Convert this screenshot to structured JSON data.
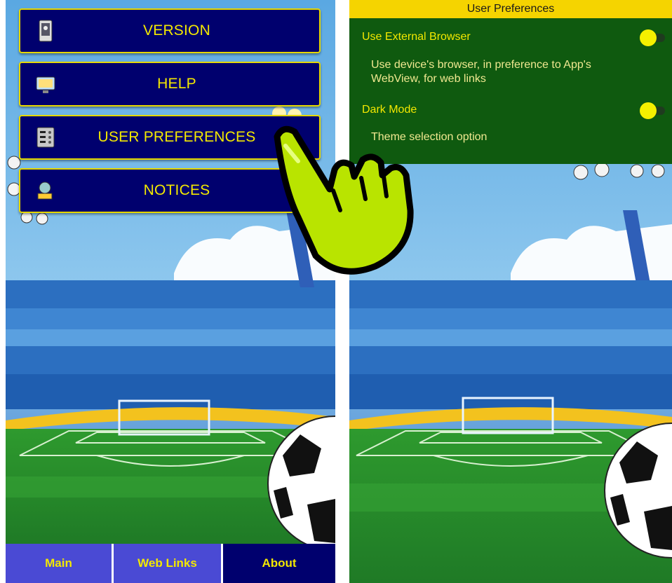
{
  "left": {
    "menu": [
      {
        "label": "VERSION",
        "icon": "phone-icon"
      },
      {
        "label": "HELP",
        "icon": "monitor-icon"
      },
      {
        "label": "USER PREFERENCES",
        "icon": "preferences-icon"
      },
      {
        "label": "NOTICES",
        "icon": "notices-icon"
      }
    ],
    "nav": [
      {
        "label": "Main",
        "state": "inactive"
      },
      {
        "label": "Web Links",
        "state": "inactive"
      },
      {
        "label": "About",
        "state": "active"
      }
    ]
  },
  "right": {
    "title": "User Preferences",
    "prefs": [
      {
        "label": "Use External Browser",
        "description": "Use device's browser, in preference to App's WebView, for web links",
        "enabled": true
      },
      {
        "label": "Dark Mode",
        "description": "Theme selection option",
        "enabled": true
      }
    ]
  },
  "colors": {
    "button_bg": "#00006e",
    "button_border": "#e6d800",
    "label_yellow": "#f3e800",
    "nav_inactive": "#4a4ad4",
    "pref_bg": "#0f5a0f",
    "pref_title_bg": "#f5d400",
    "hand_fill": "#b9e400"
  }
}
